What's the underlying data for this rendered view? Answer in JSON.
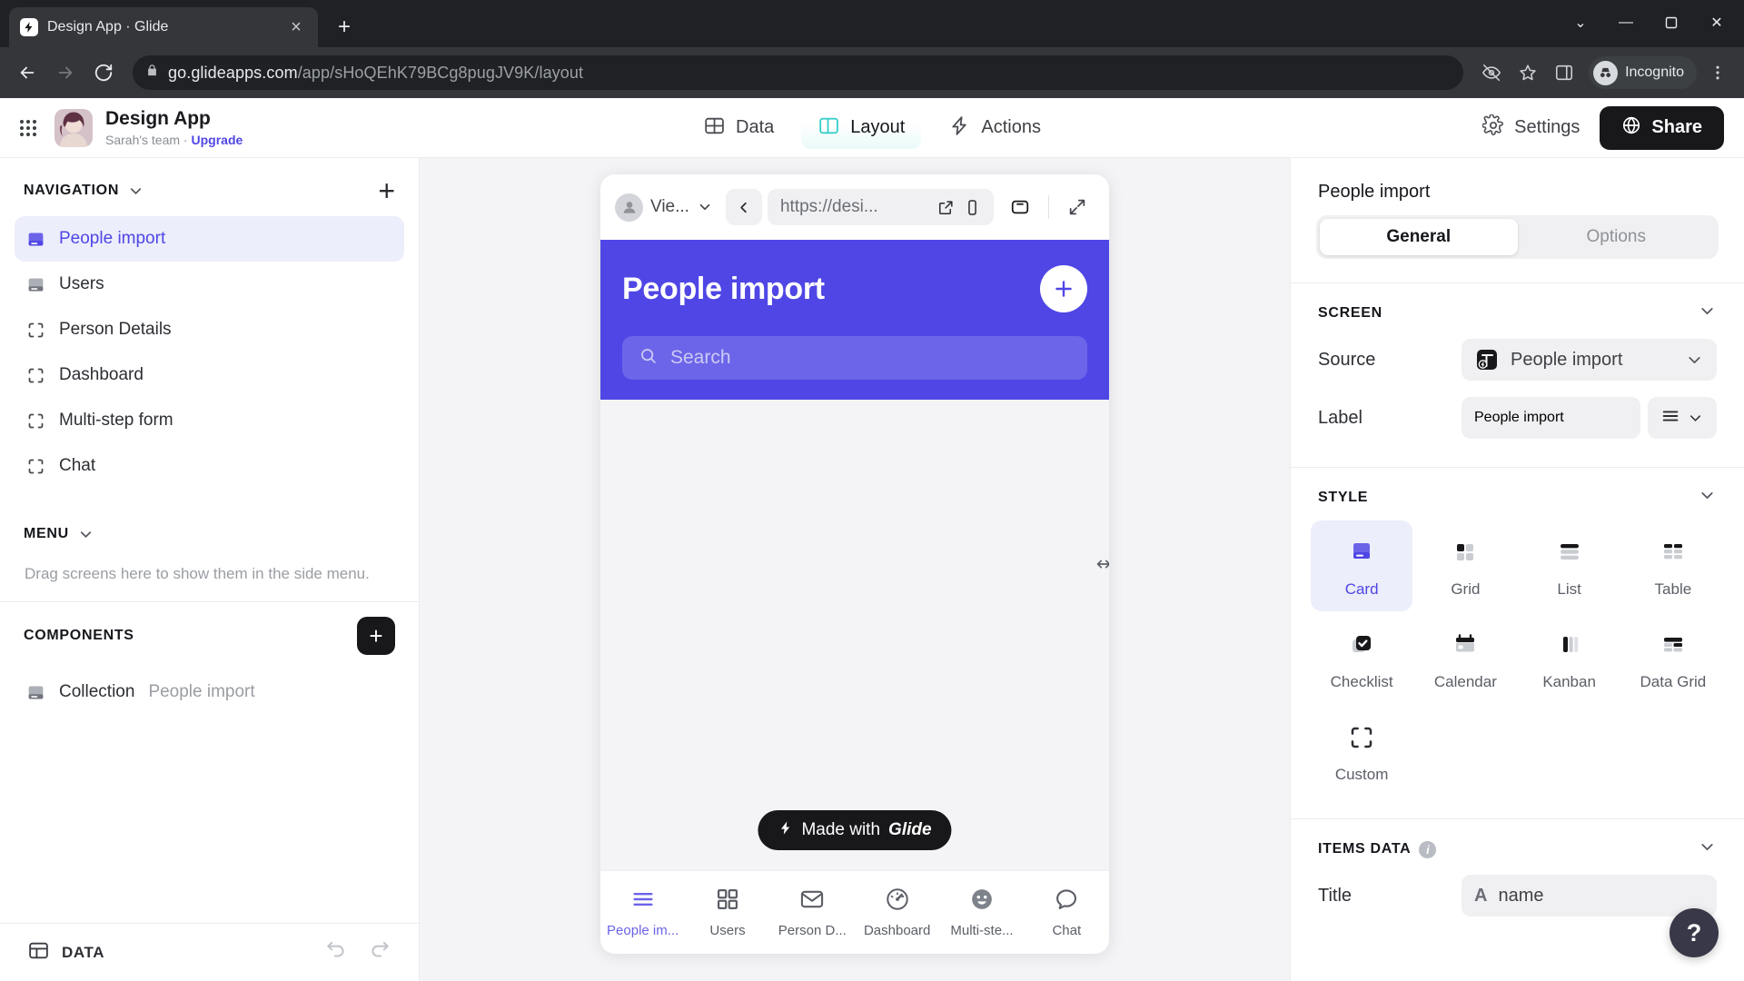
{
  "browser": {
    "tab": {
      "title": "Design App · Glide",
      "favicon": "glide-bolt-icon",
      "close": "×"
    },
    "new_tab_label": "+",
    "window_controls": {
      "minimize_group": "⌄",
      "minimize": "—",
      "maximize": "▫",
      "close": "✕"
    },
    "url": {
      "domain": "go.glideapps.com",
      "path": "/app/sHoQEhK79BCg8pugJV9K/layout"
    },
    "profile": {
      "label": "Incognito"
    }
  },
  "appbar": {
    "title": "Design App",
    "team": "Sarah's team · ",
    "upgrade": "Upgrade",
    "tabs": [
      {
        "label": "Data",
        "icon": "data-grid-icon",
        "active": false
      },
      {
        "label": "Layout",
        "icon": "layout-panels-icon",
        "active": true
      },
      {
        "label": "Actions",
        "icon": "lightning-bolt-icon",
        "active": false
      }
    ],
    "settings_label": "Settings",
    "share_label": "Share"
  },
  "sidebar": {
    "navigation": {
      "title": "NAVIGATION",
      "add_label": "+"
    },
    "nav_items": [
      {
        "label": "People import",
        "icon": "collection-screen-icon",
        "active": true
      },
      {
        "label": "Users",
        "icon": "collection-screen-icon",
        "active": false
      },
      {
        "label": "Person Details",
        "icon": "custom-screen-icon",
        "active": false
      },
      {
        "label": "Dashboard",
        "icon": "custom-screen-icon",
        "active": false
      },
      {
        "label": "Multi-step form",
        "icon": "custom-screen-icon",
        "active": false
      },
      {
        "label": "Chat",
        "icon": "custom-screen-icon",
        "active": false
      }
    ],
    "menu": {
      "title": "MENU",
      "empty_text": "Drag screens here to show them in the side menu."
    },
    "components": {
      "title": "COMPONENTS",
      "add_label": "+",
      "items": [
        {
          "name": "Collection",
          "source": "People import",
          "icon": "collection-icon"
        }
      ]
    },
    "footer": {
      "data_label": "DATA",
      "undo": "undo-icon",
      "redo": "redo-icon"
    }
  },
  "preview": {
    "toolbar": {
      "viewer_label": "Vie...",
      "url": "https://desi...",
      "back": "back-chevron-icon",
      "open_external": "open-in-new-icon",
      "device": "device-frame-icon",
      "expand": "expand-icon"
    },
    "header": {
      "title": "People import",
      "add": "+",
      "search_placeholder": "Search",
      "accent": "#4f46e5"
    },
    "badge": {
      "prefix": "Made with",
      "brand": "Glide"
    },
    "tabs": [
      {
        "label": "People im...",
        "icon": "menu-lines-icon",
        "active": true
      },
      {
        "label": "Users",
        "icon": "grid-squares-icon",
        "active": false
      },
      {
        "label": "Person D...",
        "icon": "envelope-icon",
        "active": false
      },
      {
        "label": "Dashboard",
        "icon": "gauge-icon",
        "active": false
      },
      {
        "label": "Multi-ste...",
        "icon": "smiley-icon",
        "active": false
      },
      {
        "label": "Chat",
        "icon": "chat-bubble-icon",
        "active": false
      }
    ]
  },
  "rightpanel": {
    "title": "People import",
    "tabs": [
      {
        "label": "General",
        "active": true
      },
      {
        "label": "Options",
        "active": false
      }
    ],
    "screen": {
      "title": "SCREEN",
      "source_label": "Source",
      "source_value": "People import",
      "label_label": "Label",
      "label_value": "People import"
    },
    "style": {
      "title": "STYLE",
      "options": [
        {
          "label": "Card",
          "icon": "card-style-icon",
          "active": true
        },
        {
          "label": "Grid",
          "icon": "grid-style-icon",
          "active": false
        },
        {
          "label": "List",
          "icon": "list-style-icon",
          "active": false
        },
        {
          "label": "Table",
          "icon": "table-style-icon",
          "active": false
        },
        {
          "label": "Checklist",
          "icon": "checklist-style-icon",
          "active": false
        },
        {
          "label": "Calendar",
          "icon": "calendar-style-icon",
          "active": false
        },
        {
          "label": "Kanban",
          "icon": "kanban-style-icon",
          "active": false
        },
        {
          "label": "Data Grid",
          "icon": "datagrid-style-icon",
          "active": false
        },
        {
          "label": "Custom",
          "icon": "custom-style-icon",
          "active": false
        }
      ]
    },
    "items_data": {
      "title": "ITEMS DATA",
      "info": "i",
      "title_label": "Title",
      "title_type": "A",
      "title_value": "name"
    },
    "help": "?"
  }
}
